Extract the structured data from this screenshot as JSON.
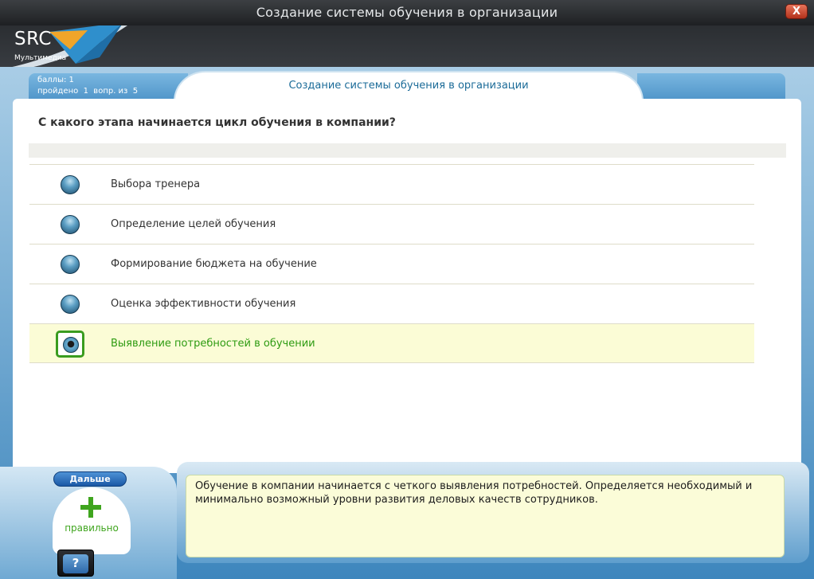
{
  "window": {
    "title": "Создание системы обучения в организации",
    "close_label": "X"
  },
  "logo": {
    "text": "SRC",
    "subtitle": "Мультимедиа"
  },
  "status": {
    "score": "баллы: 1",
    "progress": "пройдено  1  вопр. из  5"
  },
  "course_title": "Создание системы обучения в организации",
  "question": "С какого этапа начинается цикл обучения в компании?",
  "options": [
    {
      "label": "Выбора тренера",
      "selected": false
    },
    {
      "label": "Определение целей обучения",
      "selected": false
    },
    {
      "label": "Формирование бюджета на обучение",
      "selected": false
    },
    {
      "label": "Оценка эффективности обучения",
      "selected": false
    },
    {
      "label": "Выявление потребностей в обучении",
      "selected": true
    }
  ],
  "controls": {
    "next_label": "Дальше",
    "verdict": "правильно",
    "help_label": "?"
  },
  "feedback": " Обучение в компании начинается с четкого выявления потребностей. Определяется необходимый и минимально возможный уровни развития деловых качеств сотрудников.",
  "colors": {
    "accent_blue": "#1b6b98",
    "correct_green": "#3fa51e",
    "selected_row": "#fbfcd6"
  }
}
